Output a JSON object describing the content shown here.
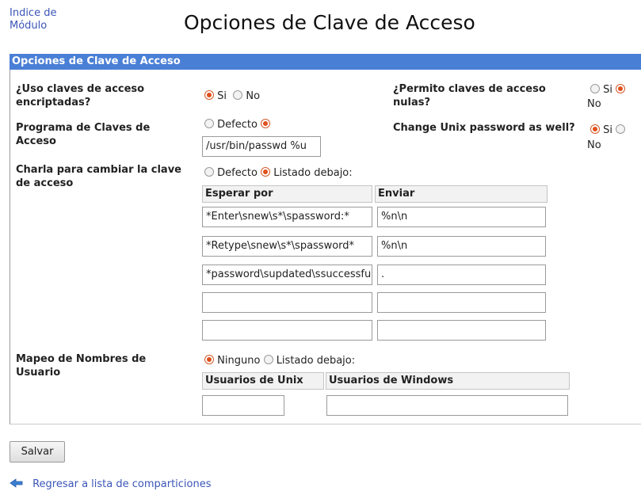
{
  "nav": {
    "module_index": "Indice de\nMódulo"
  },
  "page": {
    "title": "Opciones de Clave de Acceso"
  },
  "panel": {
    "title": "Opciones de Clave de Acceso"
  },
  "encrypt": {
    "label": "¿Uso claves de acceso encriptadas?",
    "options": [
      "Si",
      "No"
    ],
    "selected": "Si"
  },
  "null_pw": {
    "label": "¿Permito claves de acceso nulas?",
    "options": [
      "Si",
      "No"
    ],
    "selected": "No"
  },
  "pw_program": {
    "label": "Programa de Claves de Acceso",
    "default_label": "Defecto",
    "selected": "custom",
    "value": "/usr/bin/passwd %u"
  },
  "unix_pw": {
    "label": "Change Unix password as well?",
    "options": [
      "Si",
      "No"
    ],
    "selected": "Si"
  },
  "chat": {
    "label": "Charla para cambiar la clave de acceso",
    "default_label": "Defecto",
    "list_label": "Listado debajo:",
    "selected": "list",
    "col_expect": "Esperar por",
    "col_send": "Enviar",
    "rows": [
      {
        "expect": "*Enter\\snew\\s*\\spassword:*",
        "send": "%n\\n"
      },
      {
        "expect": "*Retype\\snew\\s*\\spassword*",
        "send": "%n\\n"
      },
      {
        "expect": "*password\\supdated\\ssuccessfully*",
        "send": "."
      },
      {
        "expect": "",
        "send": ""
      },
      {
        "expect": "",
        "send": ""
      }
    ]
  },
  "usermap": {
    "label": "Mapeo de Nombres de Usuario",
    "none_label": "Ninguno",
    "list_label": "Listado debajo:",
    "selected": "none",
    "col_unix": "Usuarios de Unix",
    "col_windows": "Usuarios de Windows",
    "unix_value": "",
    "windows_value": ""
  },
  "buttons": {
    "save": "Salvar"
  },
  "footer": {
    "back_link": "Regresar a lista de comparticiones"
  },
  "colors": {
    "header_bg": "#4a7fd6",
    "link": "#3b55b8",
    "radio_on": "#e04e1b"
  }
}
